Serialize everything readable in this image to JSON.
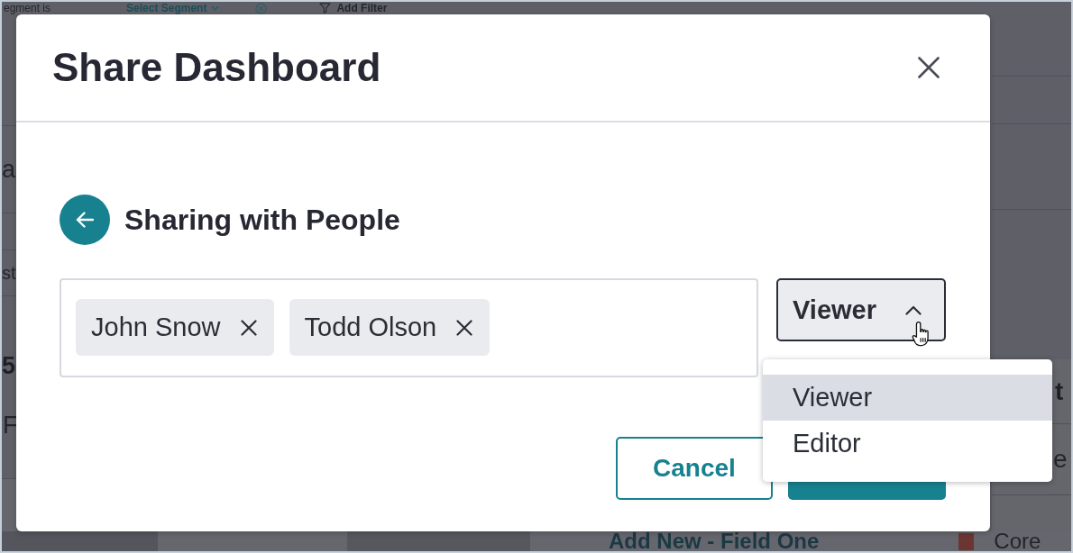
{
  "background": {
    "filter_bar": {
      "segment_label": "egment is",
      "segment_value": "Select Segment",
      "add_filter": "Add Filter"
    },
    "left_fragments": [
      "a",
      "st",
      "5",
      "F"
    ],
    "right_fragments": [
      "t",
      "e"
    ],
    "bottom_row": {
      "link": "Add New - Field One",
      "legend": {
        "label": "Core",
        "color": "#6b3631"
      }
    }
  },
  "dialog": {
    "title": "Share Dashboard",
    "section_title": "Sharing with People",
    "recipients": [
      {
        "name": "John Snow"
      },
      {
        "name": "Todd Olson"
      }
    ],
    "role_select": {
      "value": "Viewer",
      "expanded": true
    },
    "role_options": [
      {
        "label": "Viewer",
        "selected": true
      },
      {
        "label": "Editor",
        "selected": false
      }
    ],
    "buttons": [
      {
        "kind": "secondary",
        "label": "Cancel"
      },
      {
        "kind": "primary"
      }
    ]
  }
}
